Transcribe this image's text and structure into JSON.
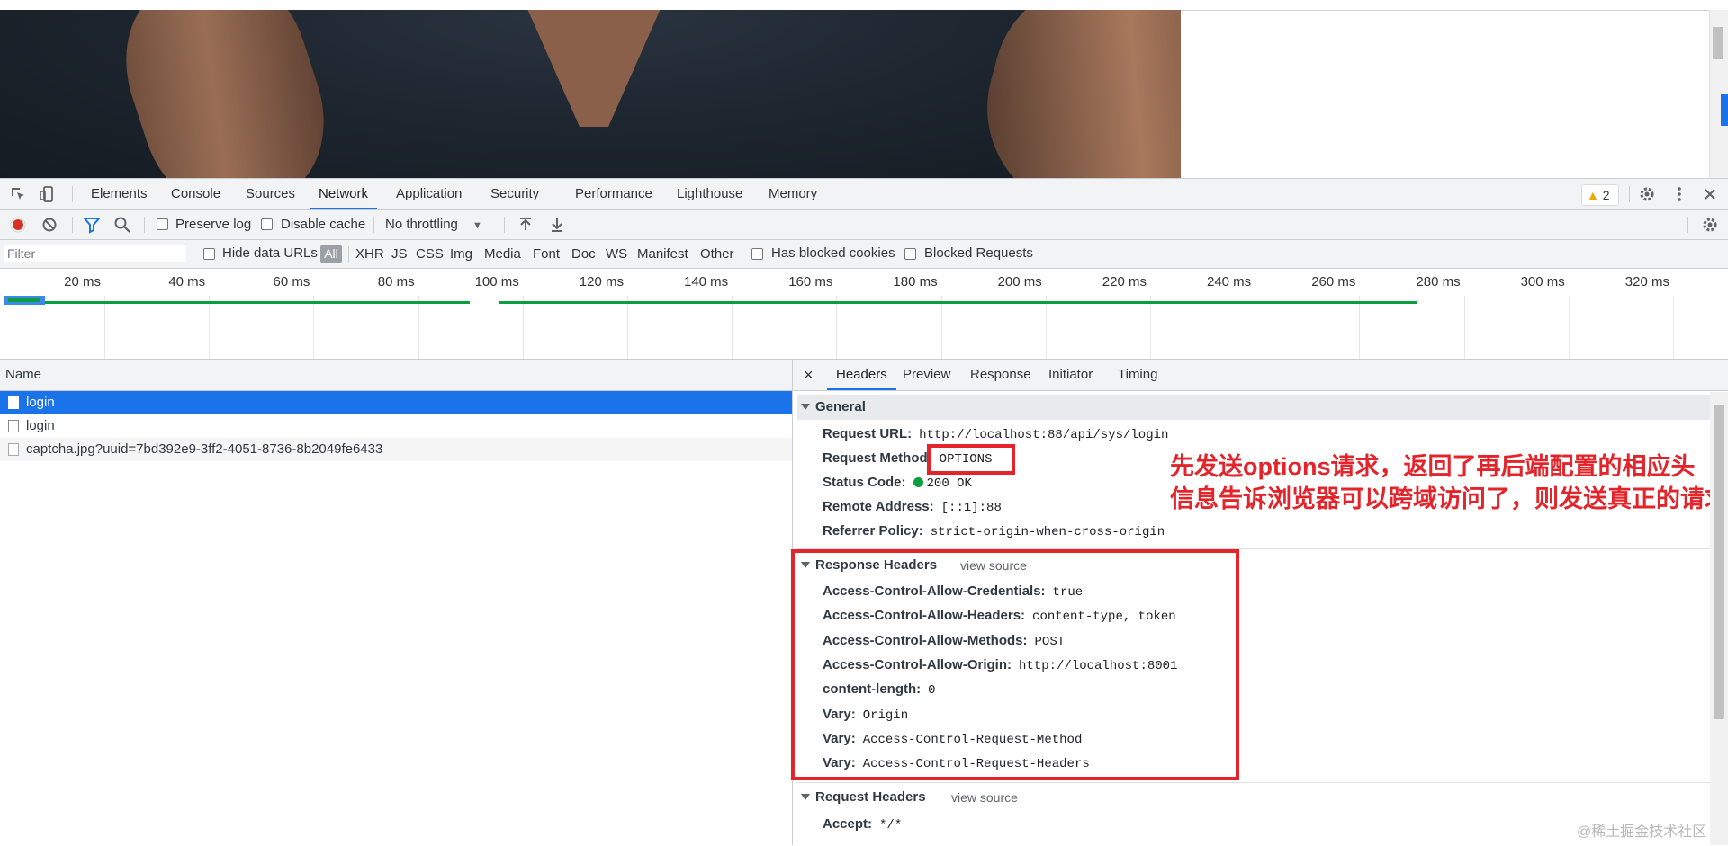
{
  "devtools": {
    "tabs": [
      "Elements",
      "Console",
      "Sources",
      "Network",
      "Application",
      "Security",
      "Performance",
      "Lighthouse",
      "Memory"
    ],
    "active_tab": "Network",
    "warning_count": "2"
  },
  "toolbar": {
    "preserve_log": "Preserve log",
    "disable_cache": "Disable cache",
    "throttling": "No throttling"
  },
  "filterbar": {
    "filter_placeholder": "Filter",
    "hide_data_urls": "Hide data URLs",
    "types": [
      "All",
      "XHR",
      "JS",
      "CSS",
      "Img",
      "Media",
      "Font",
      "Doc",
      "WS",
      "Manifest",
      "Other"
    ],
    "has_blocked_cookies": "Has blocked cookies",
    "blocked_requests": "Blocked Requests"
  },
  "overview": {
    "ticks": [
      "20 ms",
      "40 ms",
      "60 ms",
      "80 ms",
      "100 ms",
      "120 ms",
      "140 ms",
      "160 ms",
      "180 ms",
      "200 ms",
      "220 ms",
      "240 ms",
      "260 ms",
      "280 ms",
      "300 ms",
      "320 ms"
    ]
  },
  "requests": {
    "column_name": "Name",
    "rows": [
      {
        "name": "login",
        "selected": true
      },
      {
        "name": "login",
        "selected": false
      },
      {
        "name": "captcha.jpg?uuid=7bd392e9-3ff2-4051-8736-8b2049fe6433",
        "selected": false
      }
    ]
  },
  "details": {
    "close": "×",
    "tabs": [
      "Headers",
      "Preview",
      "Response",
      "Initiator",
      "Timing"
    ],
    "active_tab": "Headers",
    "general": {
      "title": "General",
      "rows": [
        {
          "key": "Request URL:",
          "value": "http://localhost:88/api/sys/login"
        },
        {
          "key": "Request Method:",
          "value": "OPTIONS"
        },
        {
          "key": "Status Code:",
          "value": "200 OK"
        },
        {
          "key": "Remote Address:",
          "value": "[::1]:88"
        },
        {
          "key": "Referrer Policy:",
          "value": "strict-origin-when-cross-origin"
        }
      ]
    },
    "response_headers": {
      "title": "Response Headers",
      "view_source": "view source",
      "rows": [
        {
          "key": "Access-Control-Allow-Credentials:",
          "value": "true"
        },
        {
          "key": "Access-Control-Allow-Headers:",
          "value": "content-type, token"
        },
        {
          "key": "Access-Control-Allow-Methods:",
          "value": "POST"
        },
        {
          "key": "Access-Control-Allow-Origin:",
          "value": "http://localhost:8001"
        },
        {
          "key": "content-length:",
          "value": "0"
        },
        {
          "key": "Vary:",
          "value": "Origin"
        },
        {
          "key": "Vary:",
          "value": "Access-Control-Request-Method"
        },
        {
          "key": "Vary:",
          "value": "Access-Control-Request-Headers"
        }
      ]
    },
    "request_headers": {
      "title": "Request Headers",
      "view_source": "view source",
      "rows": [
        {
          "key": "Accept:",
          "value": "*/*"
        }
      ]
    }
  },
  "annotation": {
    "line1": "先发送options请求，返回了再后端配置的相应头",
    "line2": "信息告诉浏览器可以跨域访问了，则发送真正的请求"
  },
  "watermark": "@稀土掘金技术社区",
  "colors": {
    "accent": "#1a73e8",
    "annotation_red": "#e3242b",
    "status_green": "#0a9e3e",
    "record_red": "#d93025"
  }
}
